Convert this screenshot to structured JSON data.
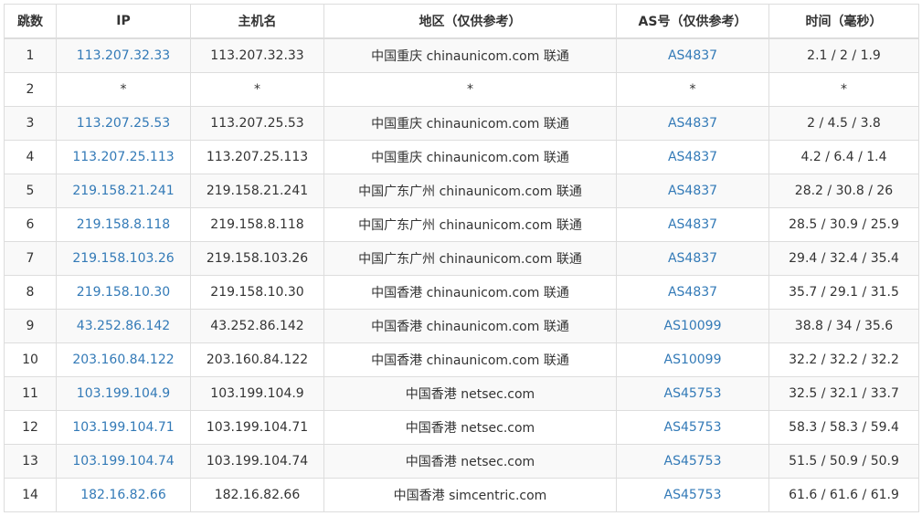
{
  "colors": {
    "link": "#337ab7",
    "text": "#333333",
    "border": "#dddddd",
    "stripe": "#f9f9f9"
  },
  "table": {
    "headers": [
      "跳数",
      "IP",
      "主机名",
      "地区（仅供参考）",
      "AS号（仅供参考）",
      "时间（毫秒）"
    ],
    "rows": [
      {
        "hop": "1",
        "ip": "113.207.32.33",
        "host": "113.207.32.33",
        "region": "中国重庆 chinaunicom.com 联通",
        "as": "AS4837",
        "time": "2.1 / 2 / 1.9"
      },
      {
        "hop": "2",
        "ip": "*",
        "host": "*",
        "region": "*",
        "as": "*",
        "time": "*"
      },
      {
        "hop": "3",
        "ip": "113.207.25.53",
        "host": "113.207.25.53",
        "region": "中国重庆 chinaunicom.com 联通",
        "as": "AS4837",
        "time": "2 / 4.5 / 3.8"
      },
      {
        "hop": "4",
        "ip": "113.207.25.113",
        "host": "113.207.25.113",
        "region": "中国重庆 chinaunicom.com 联通",
        "as": "AS4837",
        "time": "4.2 / 6.4 / 1.4"
      },
      {
        "hop": "5",
        "ip": "219.158.21.241",
        "host": "219.158.21.241",
        "region": "中国广东广州 chinaunicom.com 联通",
        "as": "AS4837",
        "time": "28.2 / 30.8 / 26"
      },
      {
        "hop": "6",
        "ip": "219.158.8.118",
        "host": "219.158.8.118",
        "region": "中国广东广州 chinaunicom.com 联通",
        "as": "AS4837",
        "time": "28.5 / 30.9 / 25.9"
      },
      {
        "hop": "7",
        "ip": "219.158.103.26",
        "host": "219.158.103.26",
        "region": "中国广东广州 chinaunicom.com 联通",
        "as": "AS4837",
        "time": "29.4 / 32.4 / 35.4"
      },
      {
        "hop": "8",
        "ip": "219.158.10.30",
        "host": "219.158.10.30",
        "region": "中国香港 chinaunicom.com 联通",
        "as": "AS4837",
        "time": "35.7 / 29.1 / 31.5"
      },
      {
        "hop": "9",
        "ip": "43.252.86.142",
        "host": "43.252.86.142",
        "region": "中国香港 chinaunicom.com 联通",
        "as": "AS10099",
        "time": "38.8 / 34 / 35.6"
      },
      {
        "hop": "10",
        "ip": "203.160.84.122",
        "host": "203.160.84.122",
        "region": "中国香港 chinaunicom.com 联通",
        "as": "AS10099",
        "time": "32.2 / 32.2 / 32.2"
      },
      {
        "hop": "11",
        "ip": "103.199.104.9",
        "host": "103.199.104.9",
        "region": "中国香港 netsec.com",
        "as": "AS45753",
        "time": "32.5 / 32.1 / 33.7"
      },
      {
        "hop": "12",
        "ip": "103.199.104.71",
        "host": "103.199.104.71",
        "region": "中国香港 netsec.com",
        "as": "AS45753",
        "time": "58.3 / 58.3 / 59.4"
      },
      {
        "hop": "13",
        "ip": "103.199.104.74",
        "host": "103.199.104.74",
        "region": "中国香港 netsec.com",
        "as": "AS45753",
        "time": "51.5 / 50.9 / 50.9"
      },
      {
        "hop": "14",
        "ip": "182.16.82.66",
        "host": "182.16.82.66",
        "region": "中国香港 simcentric.com",
        "as": "AS45753",
        "time": "61.6 / 61.6 / 61.9"
      }
    ]
  }
}
